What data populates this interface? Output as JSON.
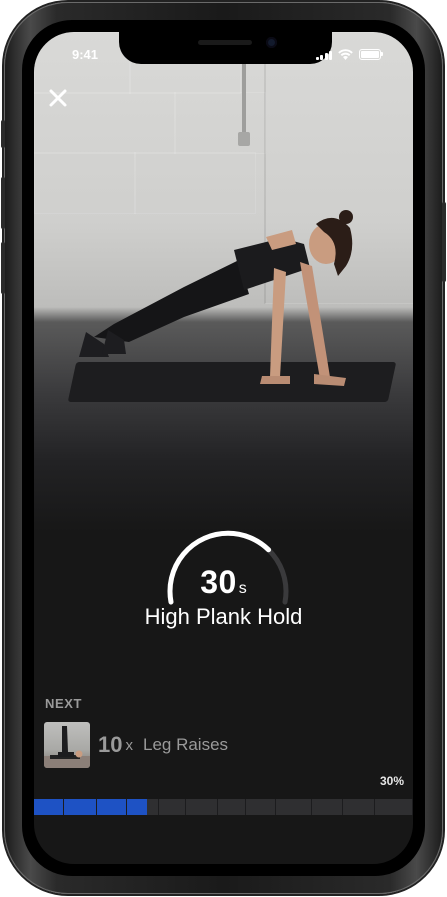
{
  "status_bar": {
    "time": "9:41"
  },
  "workout": {
    "timer_value": "30",
    "timer_unit": "s",
    "timer_progress": 0.72,
    "exercise_name": "High Plank Hold"
  },
  "next": {
    "label": "NEXT",
    "count": "10",
    "multiplier": "x",
    "exercise_name": "Leg Raises"
  },
  "progress": {
    "percent_label": "30%",
    "value": 0.3,
    "segments": 12
  },
  "colors": {
    "accent": "#1e52c4",
    "accent_light": "#2f6fe0",
    "track": "#2f2f31",
    "muted_text": "#9a9a9a"
  },
  "icons": [
    "close-icon",
    "signal-icon",
    "wifi-icon",
    "battery-icon"
  ]
}
